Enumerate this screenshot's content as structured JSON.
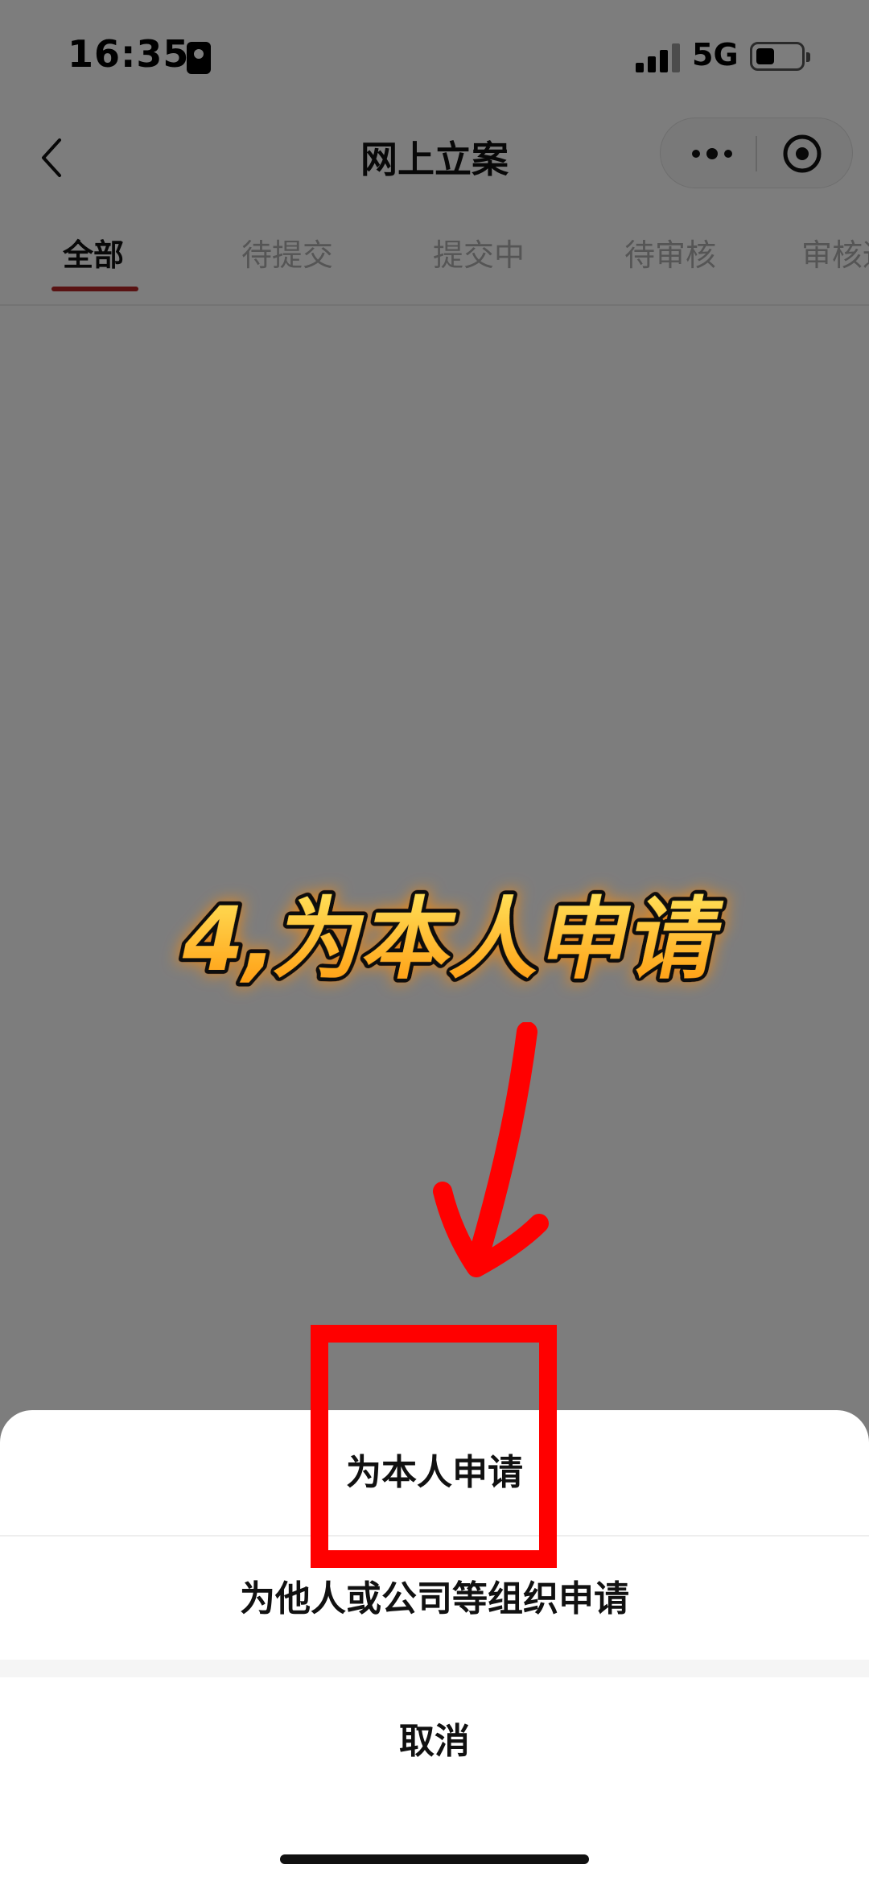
{
  "status_bar": {
    "time": "16:35",
    "network": "5G"
  },
  "nav": {
    "title": "网上立案"
  },
  "tabs": [
    {
      "label": "全部",
      "active": true
    },
    {
      "label": "待提交",
      "active": false
    },
    {
      "label": "提交中",
      "active": false
    },
    {
      "label": "待审核",
      "active": false
    },
    {
      "label": "审核通",
      "active": false
    }
  ],
  "overlay": {
    "callout": "4,为本人申请"
  },
  "sheet": {
    "option_self": "为本人申请",
    "option_others": "为他人或公司等组织申请",
    "cancel": "取消"
  },
  "colors": {
    "accent": "#b32626",
    "highlight": "#ff0000",
    "callout_fill": "#ffc21a"
  }
}
